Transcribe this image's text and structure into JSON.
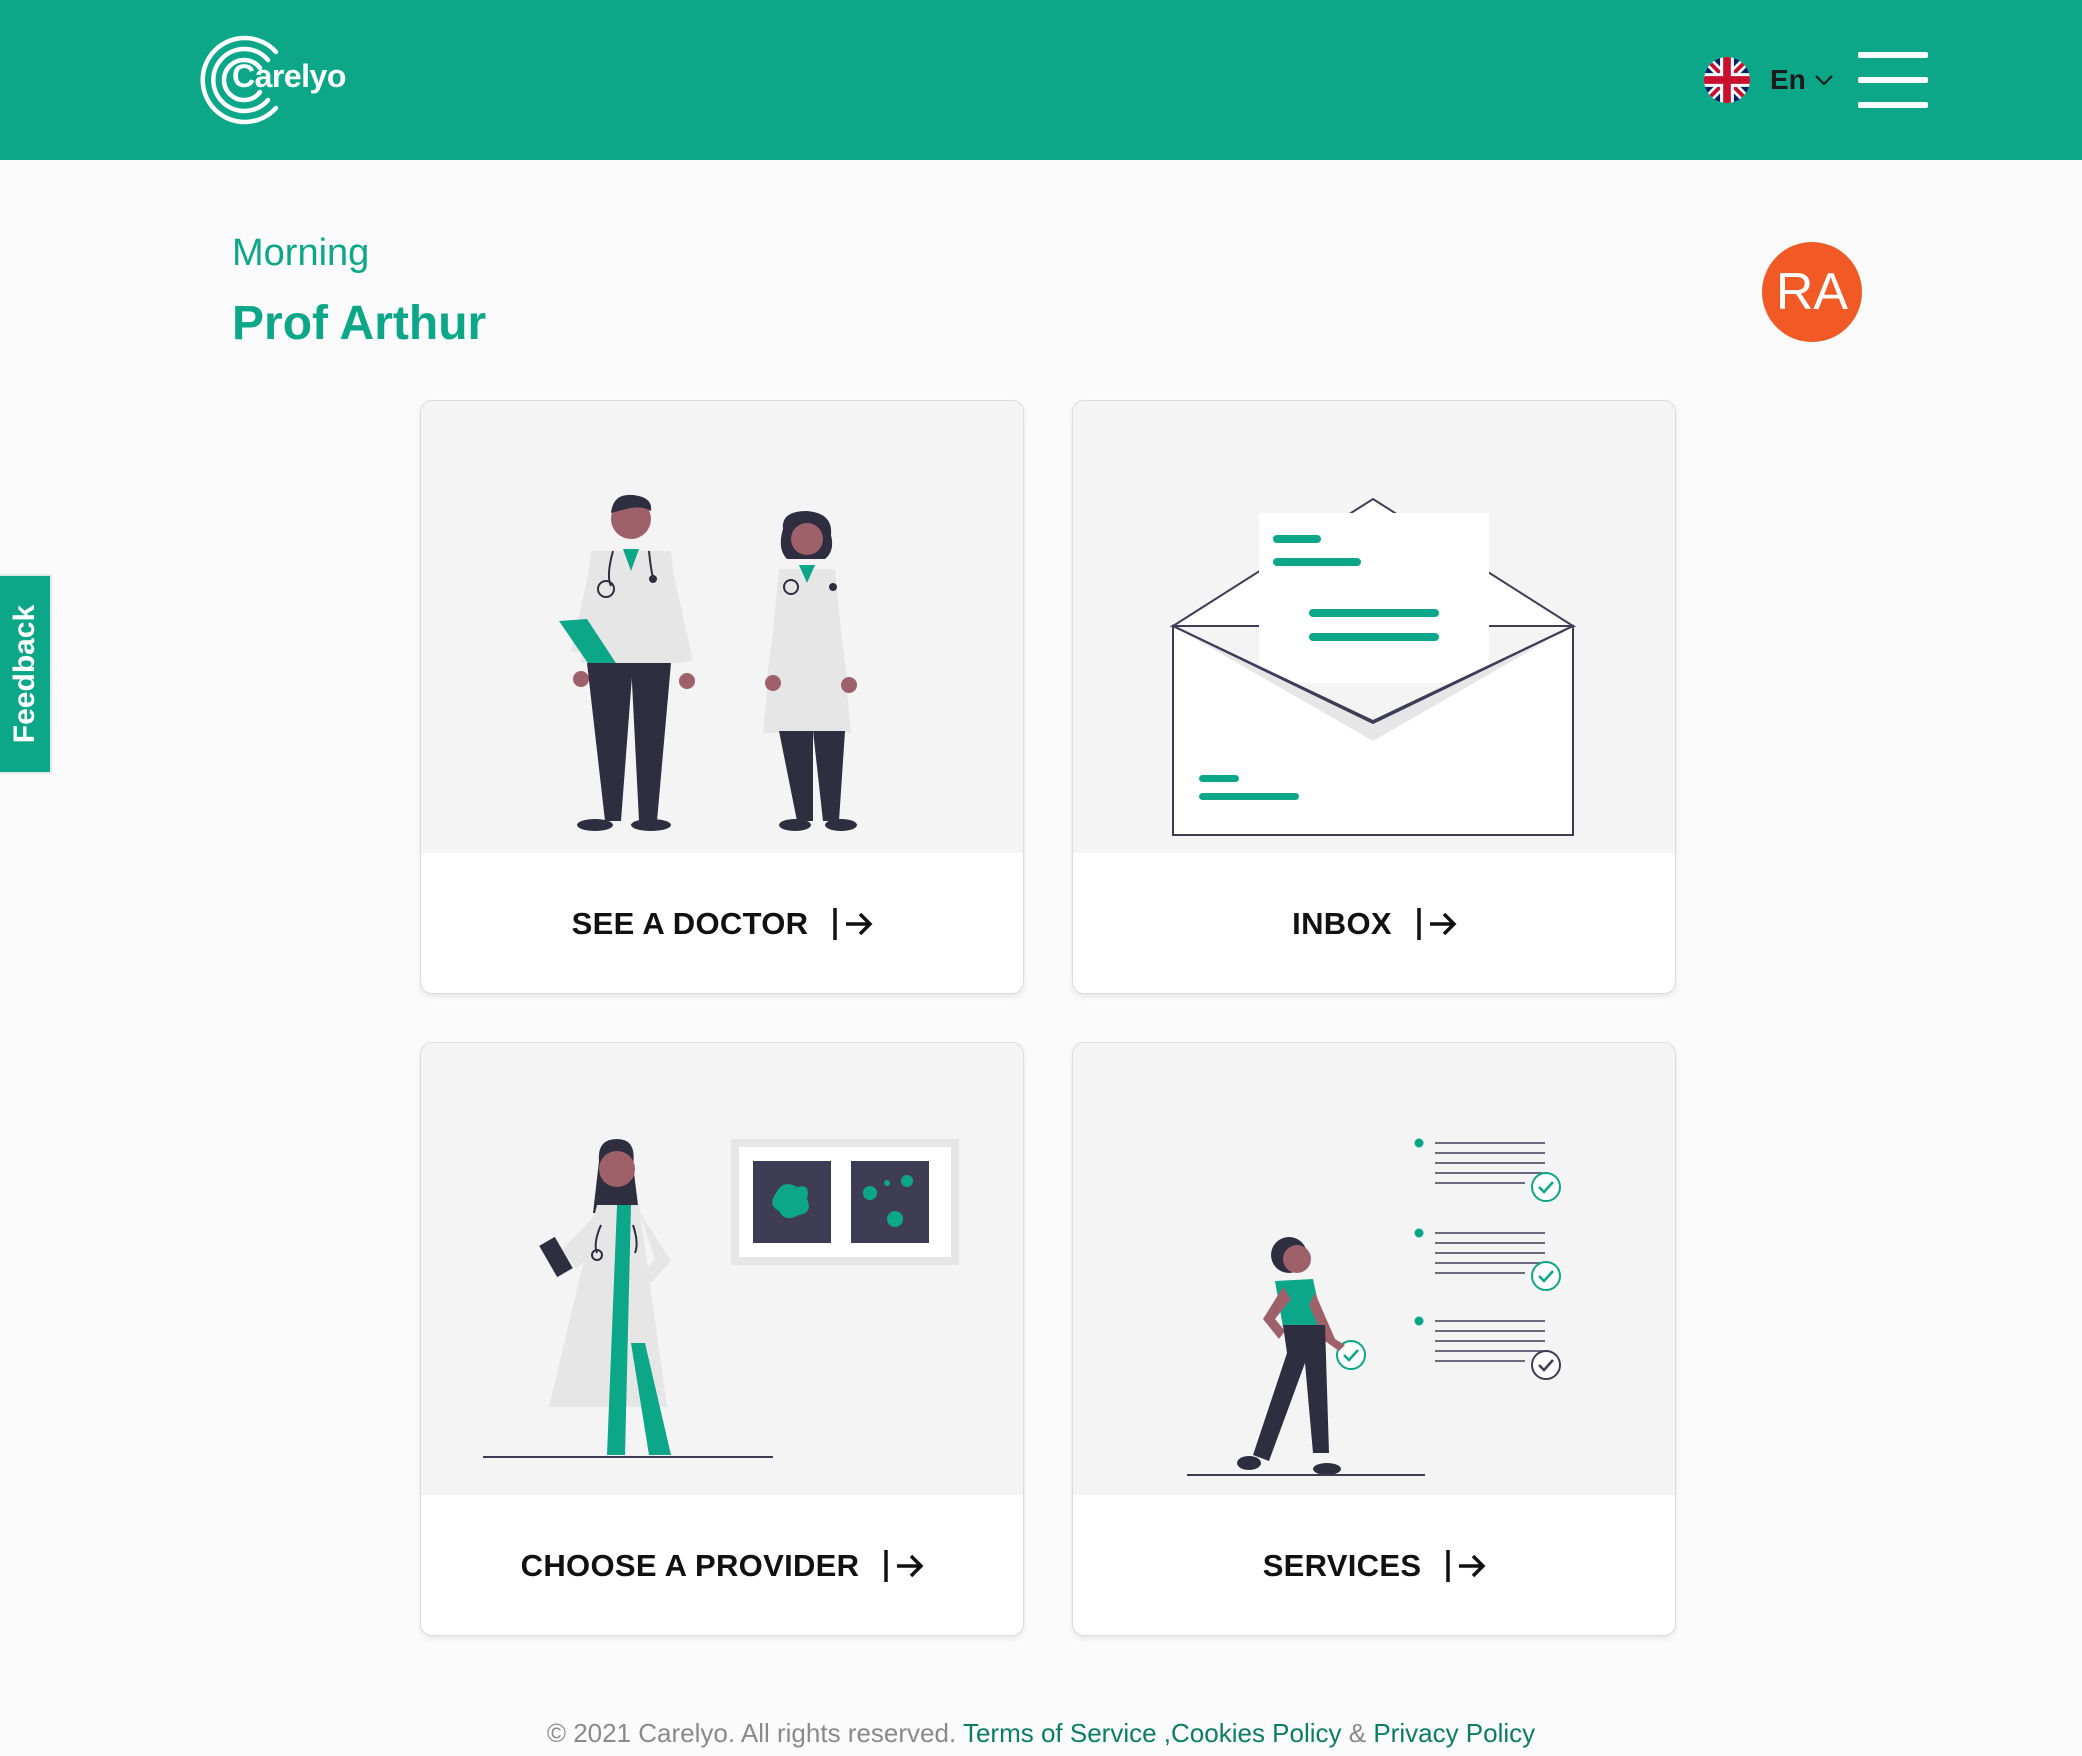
{
  "header": {
    "brand": "Carelyo",
    "language": {
      "label": "En",
      "flag_icon": "uk-flag-icon"
    },
    "menu_icon": "hamburger-menu-icon"
  },
  "greeting": {
    "salutation": "Morning",
    "name": "Prof Arthur"
  },
  "avatar": {
    "initials": "RA",
    "color": "#f15a24"
  },
  "feedback_tab": {
    "label": "Feedback"
  },
  "cards": [
    {
      "label": "SEE A DOCTOR",
      "illustration": "doctors-illustration",
      "arrow_icon": "arrow-right-icon"
    },
    {
      "label": "INBOX",
      "illustration": "envelope-illustration",
      "arrow_icon": "arrow-right-icon"
    },
    {
      "label": "CHOOSE A PROVIDER",
      "illustration": "provider-illustration",
      "arrow_icon": "arrow-right-icon"
    },
    {
      "label": "SERVICES",
      "illustration": "checklist-illustration",
      "arrow_icon": "arrow-right-icon"
    }
  ],
  "footer": {
    "copyright": "© 2021 Carelyo. All rights reserved.",
    "terms": "Terms of Service",
    "cookies": ",Cookies Policy",
    "amp": "&",
    "privacy": "Privacy Policy"
  },
  "colors": {
    "brand": "#0ca789",
    "text_dark": "#111111",
    "illustration_bg": "#f4f4f4"
  }
}
